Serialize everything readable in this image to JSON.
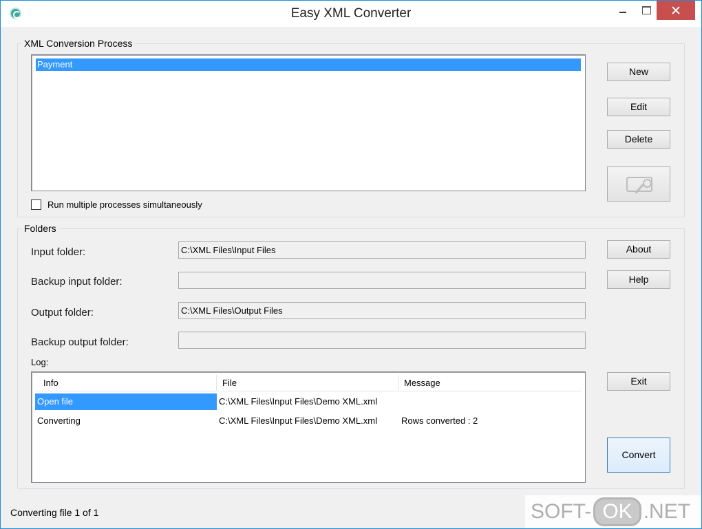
{
  "window": {
    "title": "Easy XML Converter"
  },
  "process_group": {
    "label": "XML Conversion Process",
    "items": [
      {
        "label": "Payment",
        "selected": true
      }
    ],
    "run_multiple_label": "Run multiple processes simultaneously",
    "run_multiple_checked": false
  },
  "side_buttons": {
    "new": "New",
    "edit": "Edit",
    "delete": "Delete",
    "about": "About",
    "help": "Help",
    "exit": "Exit",
    "convert": "Convert"
  },
  "folders_group": {
    "label": "Folders",
    "input_label": "Input folder:",
    "input_value": "C:\\XML Files\\Input Files",
    "backup_input_label": "Backup input folder:",
    "backup_input_value": "",
    "output_label": "Output folder:",
    "output_value": "C:\\XML Files\\Output Files",
    "backup_output_label": "Backup output folder:",
    "backup_output_value": ""
  },
  "log": {
    "label": "Log:",
    "columns": [
      "Info",
      "File",
      "Message"
    ],
    "rows": [
      {
        "info": "Open file",
        "file": "C:\\XML Files\\Input Files\\Demo XML.xml",
        "message": ""
      },
      {
        "info": "Converting",
        "file": "C:\\XML Files\\Input Files\\Demo XML.xml",
        "message": "Rows converted : 2"
      }
    ]
  },
  "status": {
    "text": "Converting file 1 of 1"
  },
  "watermark": {
    "part1": "SOFT-",
    "part2": "OK",
    "part3": ".NET"
  },
  "colors": {
    "selection": "#3399ff",
    "close_button": "#c7504f",
    "window_border": "#1c8fd6"
  }
}
